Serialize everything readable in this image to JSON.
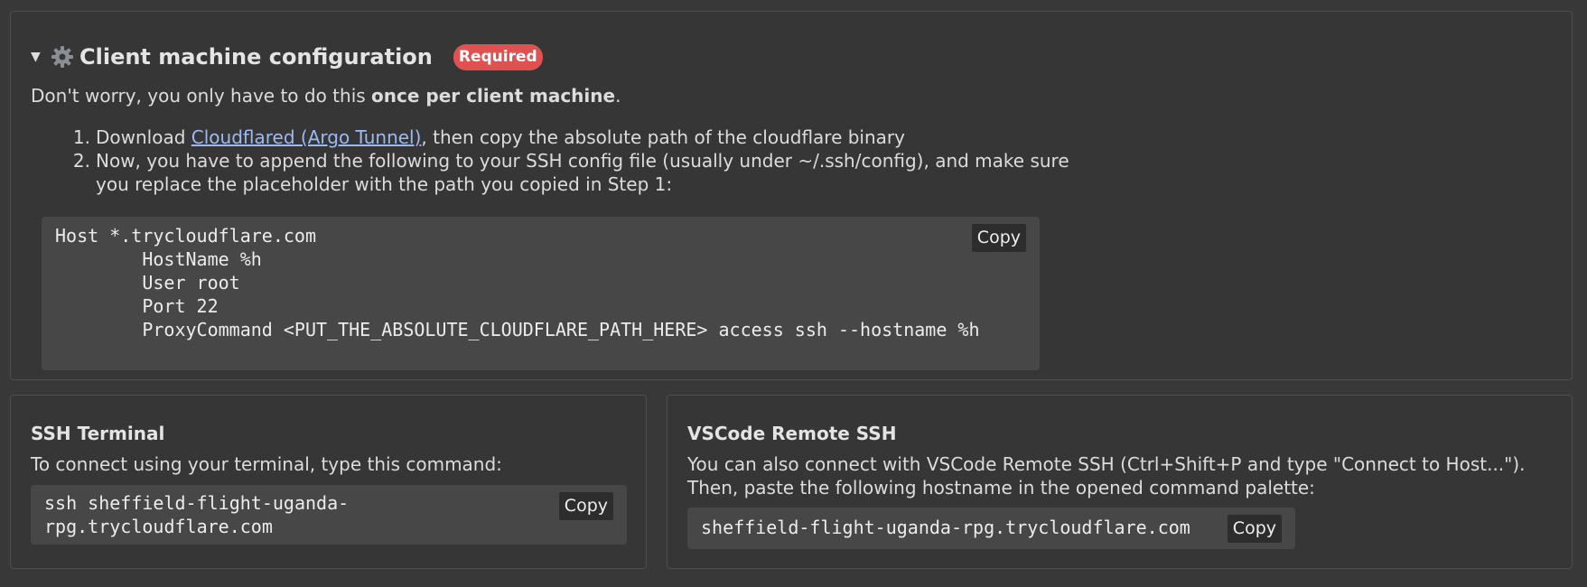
{
  "config": {
    "title": "Client machine configuration",
    "badge": "Required",
    "intro_prefix": "Don't worry, you only have to do this ",
    "intro_bold": "once per client machine",
    "intro_suffix": ".",
    "step1_prefix": "Download ",
    "step1_link": "Cloudflared (Argo Tunnel)",
    "step1_suffix": ", then copy the absolute path of the cloudflare binary",
    "step2": "Now, you have to append the following to your SSH config file (usually under ~/.ssh/config), and make sure you replace the placeholder with the path you copied in Step 1:",
    "code": "Host *.trycloudflare.com\n        HostName %h\n        User root\n        Port 22\n        ProxyCommand <PUT_THE_ABSOLUTE_CLOUDFLARE_PATH_HERE> access ssh --hostname %h",
    "copy_label": "Copy"
  },
  "ssh_terminal": {
    "title": "SSH Terminal",
    "description": "To connect using your terminal, type this command:",
    "command": "ssh sheffield-flight-uganda-rpg.trycloudflare.com",
    "copy_label": "Copy"
  },
  "vscode": {
    "title": "VSCode Remote SSH",
    "description": "You can also connect with VSCode Remote SSH (Ctrl+Shift+P and type \"Connect to Host...\"). Then, paste the following hostname in the opened command palette:",
    "hostname": "sheffield-flight-uganda-rpg.trycloudflare.com",
    "copy_label": "Copy"
  },
  "icons": {
    "collapse": "caret-down-icon",
    "settings": "gear-icon"
  },
  "colors": {
    "background": "#383838",
    "badge": "#e05252",
    "link": "#9db9f0",
    "code_background": "#474747"
  }
}
